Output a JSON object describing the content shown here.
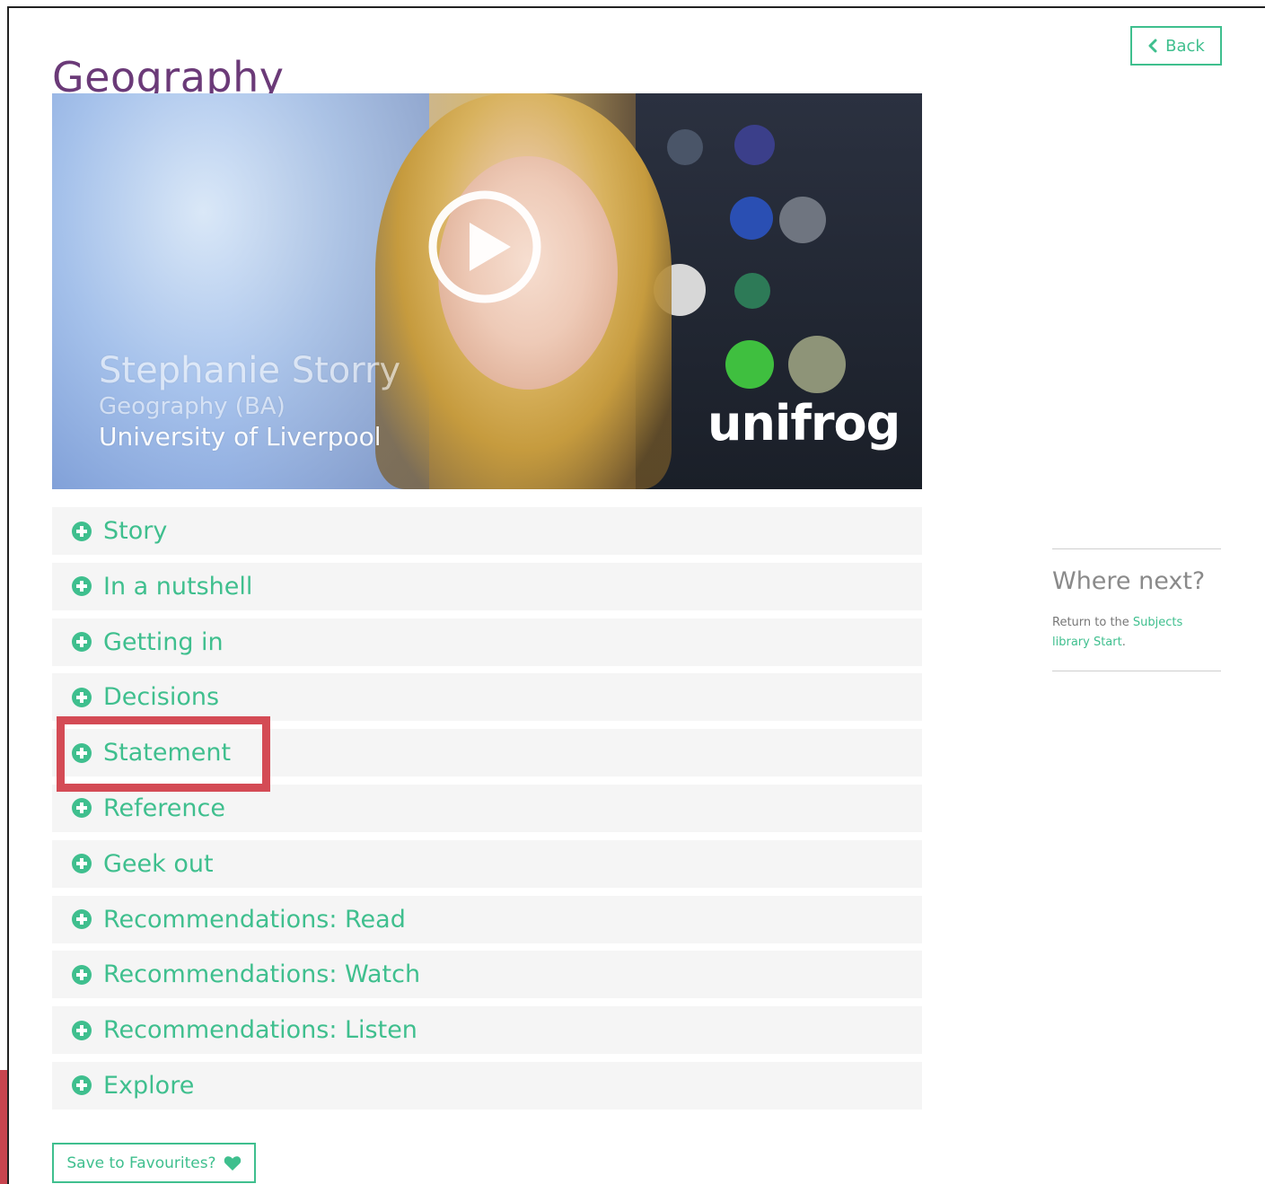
{
  "page": {
    "title": "Geography",
    "back_label": "Back"
  },
  "video": {
    "presenter_name": "Stephanie Storry",
    "course": "Geography (BA)",
    "university": "University of Liverpool",
    "brand": "unifrog"
  },
  "accordion": {
    "items": [
      {
        "label": "Story"
      },
      {
        "label": "In a nutshell"
      },
      {
        "label": "Getting in"
      },
      {
        "label": "Decisions"
      },
      {
        "label": "Statement"
      },
      {
        "label": "Reference"
      },
      {
        "label": "Geek out"
      },
      {
        "label": "Recommendations: Read"
      },
      {
        "label": "Recommendations: Watch"
      },
      {
        "label": "Recommendations: Listen"
      },
      {
        "label": "Explore"
      }
    ]
  },
  "favourites": {
    "label": "Save to Favourites?"
  },
  "sidebar": {
    "heading": "Where next?",
    "text_before": "Return to the ",
    "link_text": "Subjects library Start",
    "text_after": "."
  },
  "colors": {
    "title": "#6b3a78",
    "accent": "#3fbf8e",
    "highlight": "#d44b55",
    "row_bg": "#f5f5f5"
  }
}
